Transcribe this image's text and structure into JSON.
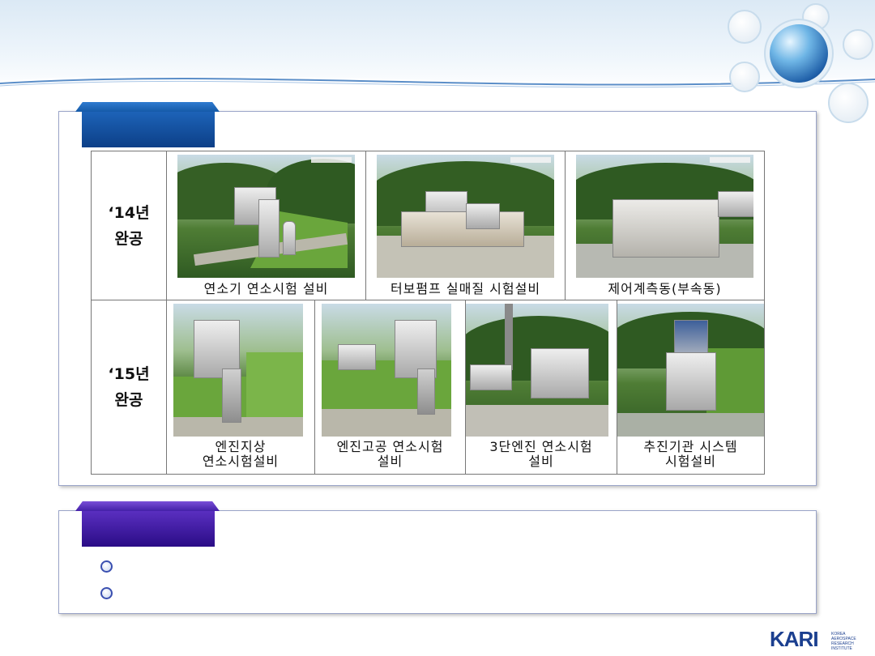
{
  "table": {
    "rows": [
      {
        "year": "‘14년",
        "status": "완공",
        "facilities": [
          {
            "caption_line1": "연소기 연소시험 설비",
            "caption_line2": ""
          },
          {
            "caption_line1": "터보펌프 실매질 시험설비",
            "caption_line2": ""
          },
          {
            "caption_line1": "제어계측동(부속동)",
            "caption_line2": ""
          }
        ]
      },
      {
        "year": "‘15년",
        "status": "완공",
        "facilities": [
          {
            "caption_line1": "엔진지상",
            "caption_line2": "연소시험설비"
          },
          {
            "caption_line1": "엔진고공 연소시험",
            "caption_line2": "설비"
          },
          {
            "caption_line1": "3단엔진 연소시험",
            "caption_line2": "설비"
          },
          {
            "caption_line1": "추진기관 시스템",
            "caption_line2": "시험설비"
          }
        ]
      }
    ]
  },
  "footer_logo": {
    "word": "KARI",
    "sub": [
      "KOREA",
      "AEROSPACE",
      "RESEARCH INSTITUTE"
    ]
  },
  "colors": {
    "tab_blue": "#0c3f87",
    "tab_purple": "#2a0c86",
    "panel_border": "#9aa4c8"
  }
}
